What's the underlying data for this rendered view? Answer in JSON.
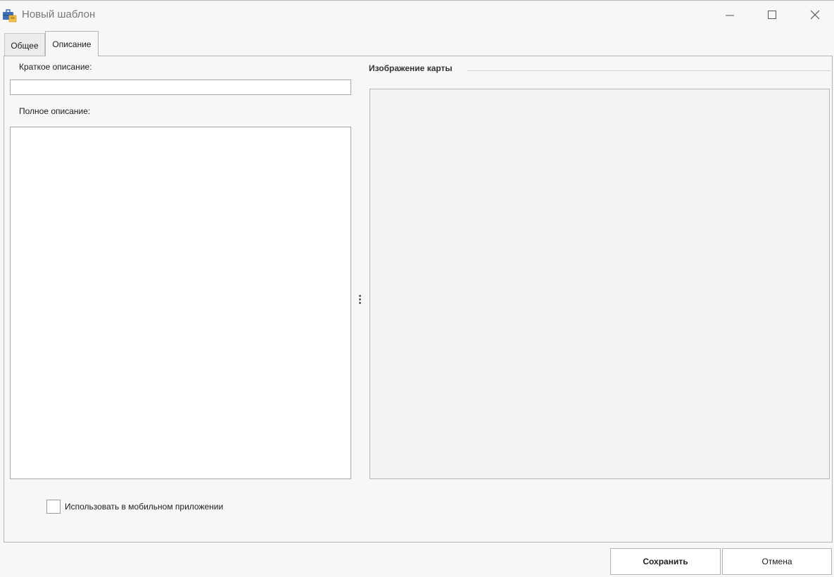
{
  "window": {
    "title": "Новый шаблон",
    "icon": "template-briefcase-icon",
    "controls": [
      "minimize-icon",
      "maximize-icon",
      "close-icon"
    ]
  },
  "tabs": [
    {
      "label": "Общее",
      "active": false
    },
    {
      "label": "Описание",
      "active": true
    }
  ],
  "form": {
    "short_description_label": "Краткое описание:",
    "short_description_value": "",
    "full_description_label": "Полное описание:",
    "full_description_value": "",
    "map_image_group_title": "Изображение карты",
    "use_in_mobile_app_label": "Использовать в мобильном приложении",
    "use_in_mobile_app_checked": false
  },
  "buttons": {
    "save_label": "Сохранить",
    "cancel_label": "Отмена"
  },
  "colors": {
    "background": "#f7f7f7",
    "border": "#b4b4b4",
    "icon_blue": "#3f6fb5",
    "icon_yellow": "#f2c14e"
  }
}
